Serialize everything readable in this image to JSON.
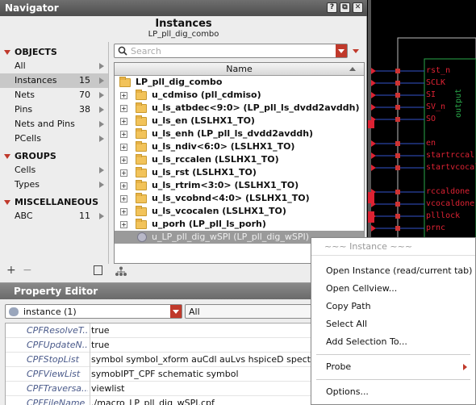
{
  "navigator": {
    "title": "Navigator",
    "title_buttons": [
      "?",
      "⧉",
      "✕"
    ],
    "header_title": "Instances",
    "header_subtitle": "LP_pll_dig_combo",
    "search_placeholder": "Search",
    "column_name": "Name"
  },
  "categories": {
    "objects_label": "OBJECTS",
    "objects": [
      {
        "label": "All",
        "count": ""
      },
      {
        "label": "Instances",
        "count": "15"
      },
      {
        "label": "Nets",
        "count": "70"
      },
      {
        "label": "Pins",
        "count": "38"
      },
      {
        "label": "Nets and Pins",
        "count": ""
      },
      {
        "label": "PCells",
        "count": ""
      }
    ],
    "groups_label": "GROUPS",
    "groups": [
      {
        "label": "Cells",
        "count": ""
      },
      {
        "label": "Types",
        "count": ""
      }
    ],
    "misc_label": "MISCELLANEOUS",
    "misc": [
      {
        "label": "ABC",
        "count": "11"
      }
    ],
    "footer_add": "+",
    "footer_remove": "−"
  },
  "tree": {
    "root": "LP_pll_dig_combo",
    "items": [
      "u_cdmiso (pll_cdmiso)",
      "u_ls_atbdec<9:0> (LP_pll_ls_dvdd2avddh)",
      "u_ls_en (LSLHX1_TO)",
      "u_ls_enh (LP_pll_ls_dvdd2avddh)",
      "u_ls_ndiv<6:0> (LSLHX1_TO)",
      "u_ls_rccalen (LSLHX1_TO)",
      "u_ls_rst (LSLHX1_TO)",
      "u_ls_rtrim<3:0> (LSLHX1_TO)",
      "u_ls_vcobnd<4:0> (LSLHX1_TO)",
      "u_ls_vcocalen (LSLHX1_TO)",
      "u_porh (LP_pll_ls_porh)"
    ],
    "selected": "u_LP_pll_dig_wSPI (LP_pll_dig_wSPI)"
  },
  "property_editor": {
    "title": "Property Editor",
    "selector_value": "instance (1)",
    "filter_value": "All",
    "rows": [
      {
        "key": "CPFResolveT...",
        "value": "true"
      },
      {
        "key": "CPFUpdateN...",
        "value": "true"
      },
      {
        "key": "CPFStopList",
        "value": "symbol symbol_xform auCdl auLvs hspiceD spectre"
      },
      {
        "key": "CPFViewList",
        "value": "symobIPT_CPF schematic symbol"
      },
      {
        "key": "CPFTraversa...",
        "value": "viewlist"
      },
      {
        "key": "CPFFileName",
        "value": "./macro_LP_pll_dig_wSPI.cpf"
      }
    ]
  },
  "schematic": {
    "pins": [
      "rst_n",
      "SCLK",
      "SI",
      "SV_n",
      "SO",
      "en",
      "startrccal",
      "startvcocal",
      "rccaldone",
      "vcocaldone",
      "plllock",
      "prnc"
    ],
    "output_label": "output"
  },
  "context_menu": {
    "header": "~~~ Instance ~~~",
    "items": [
      "Open Instance (read/current tab)",
      "Open Cellview...",
      "Copy Path",
      "Select All",
      "Add Selection To..."
    ],
    "items2": [
      "Probe"
    ],
    "items3": [
      "Options..."
    ]
  },
  "colors": {
    "accent": "#c0392b",
    "schematic_pin": "#dd2233",
    "schematic_wire": "#3355cc"
  }
}
